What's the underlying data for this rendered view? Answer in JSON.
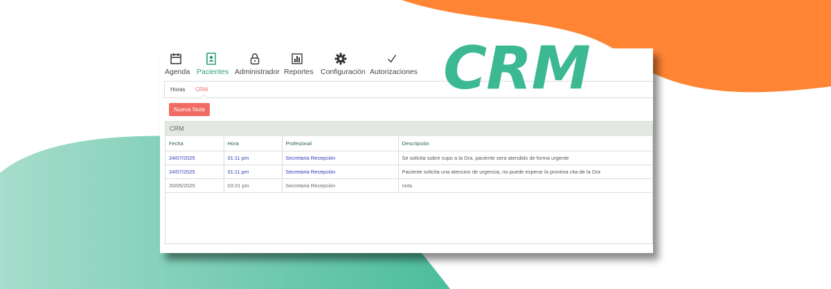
{
  "nav": [
    {
      "label": "Agenda",
      "icon": "calendar-icon",
      "active": false
    },
    {
      "label": "Pacientes",
      "icon": "address-book-icon",
      "active": true
    },
    {
      "label": "Administrador",
      "icon": "lock-icon",
      "active": false
    },
    {
      "label": "Reportes",
      "icon": "bar-chart-icon",
      "active": false
    },
    {
      "label": "Configuración",
      "icon": "gear-icon",
      "active": false
    },
    {
      "label": "Autorizaciones",
      "icon": "checkmark-icon",
      "active": false
    }
  ],
  "subtabs": [
    {
      "label": "Horas",
      "active": false
    },
    {
      "label": "CRM",
      "active": true
    }
  ],
  "new_note_label": "Nueva Nota",
  "crm_section_title": "CRM",
  "table": {
    "headers": [
      "Fecha",
      "Hora",
      "Profesional",
      "Descripción"
    ],
    "rows": [
      [
        "24/07/2025",
        "01:11 pm",
        "Secretaria Recepción",
        "Se solicita sobre cupo a la Dra, paciente sera atendido de forma urgente"
      ],
      [
        "24/07/2025",
        "01:11 pm",
        "Secretaria Recepción",
        "Paciente solicita una atencion de urgencia, no puede esperar la proxima cita de la Dra"
      ],
      [
        "20/05/2025",
        "03:31 pm",
        "Secretaria Recepción",
        "nota"
      ]
    ]
  },
  "logo_text": "CRM",
  "colors": {
    "accent_green": "#3cb892",
    "orange": "#ff8433",
    "button_red": "#ef6b63",
    "link_blue": "#2b3bb5"
  }
}
